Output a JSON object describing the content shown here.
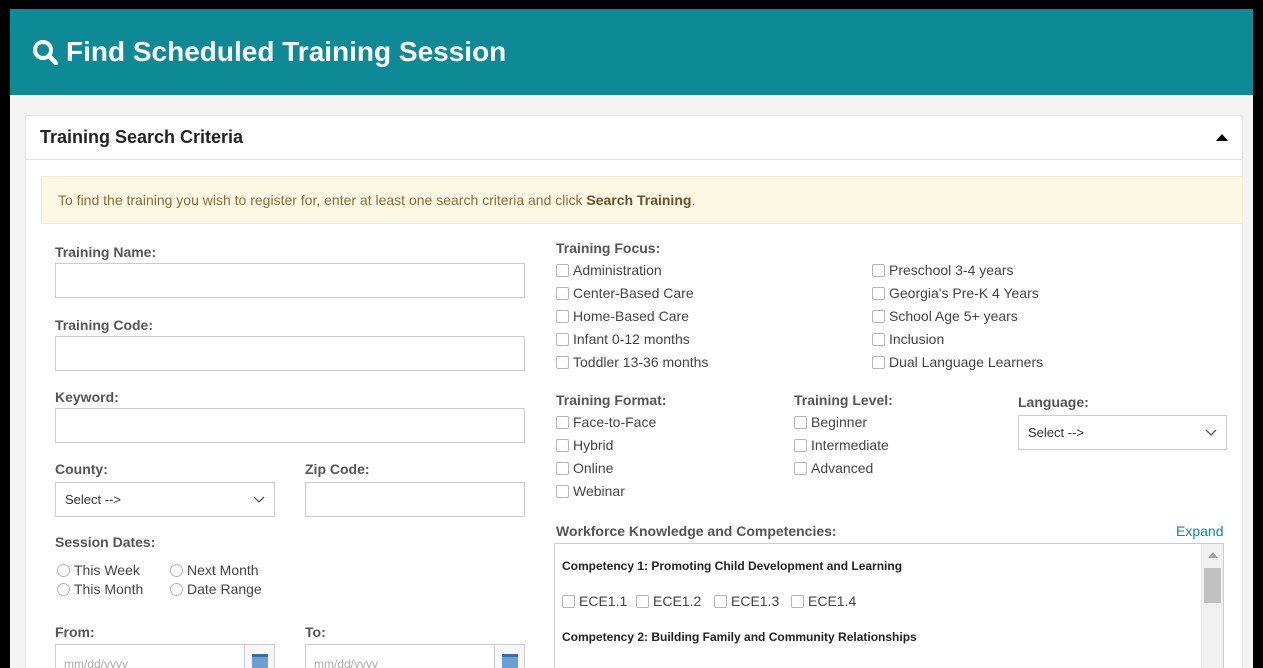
{
  "header": {
    "title": "Find Scheduled Training Session",
    "icon": "search-icon"
  },
  "panel": {
    "title": "Training Search Criteria",
    "collapse_icon": "caret-up-icon"
  },
  "notice": {
    "text": "To find the training you wish to register for, enter at least one search criteria and click ",
    "bold": "Search Training",
    "end": "."
  },
  "left": {
    "training_name_label": "Training Name:",
    "training_code_label": "Training Code:",
    "keyword_label": "Keyword:",
    "county_label": "County:",
    "county_value": "Select -->",
    "zip_label": "Zip Code:",
    "session_dates_label": "Session Dates:",
    "session_dates": [
      "This Week",
      "Next Month",
      "This Month",
      "Date Range"
    ],
    "from_label": "From:",
    "to_label": "To:",
    "from_placeholder": "mm/dd/yyyy",
    "to_placeholder": "mm/dd/yyyy"
  },
  "focus": {
    "label": "Training Focus:",
    "col1": [
      "Administration",
      "Center-Based Care",
      "Home-Based Care",
      "Infant 0-12 months",
      "Toddler 13-36 months"
    ],
    "col2": [
      "Preschool 3-4 years",
      "Georgia's Pre-K 4 Years",
      "School Age 5+ years",
      "Inclusion",
      "Dual Language Learners"
    ]
  },
  "format": {
    "label": "Training Format:",
    "items": [
      "Face-to-Face",
      "Hybrid",
      "Online",
      "Webinar"
    ]
  },
  "level": {
    "label": "Training Level:",
    "items": [
      "Beginner",
      "Intermediate",
      "Advanced"
    ]
  },
  "language": {
    "label": "Language:",
    "value": "Select -->"
  },
  "competencies": {
    "label": "Workforce Knowledge and Competencies:",
    "expand": "Expand",
    "c1_title": "Competency 1: Promoting Child Development and Learning",
    "c1_items": [
      "ECE1.1",
      "ECE1.2",
      "ECE1.3",
      "ECE1.4"
    ],
    "c2_title": "Competency 2: Building Family and Community Relationships"
  }
}
